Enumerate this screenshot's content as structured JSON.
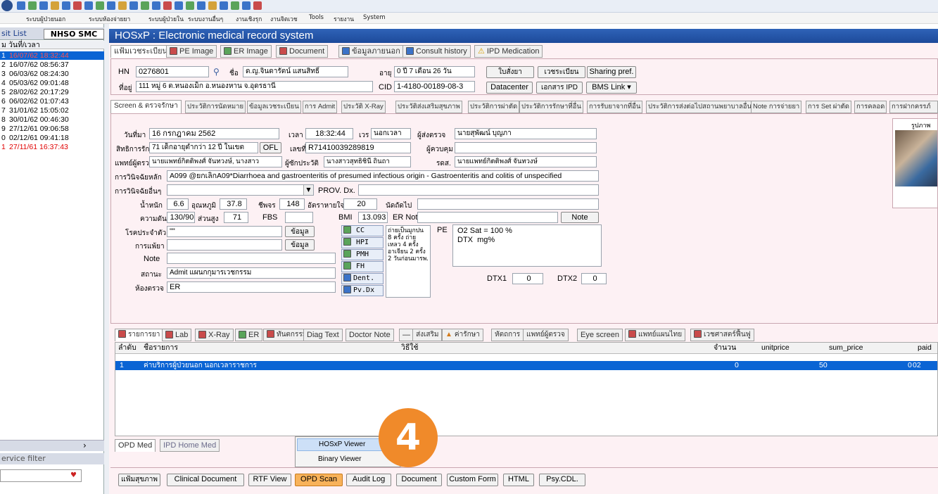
{
  "menubar": [
    "ระบบผู้ป่วยนอก",
    "ระบบห้องจ่ายยา",
    "ระบบผู้ป่วยใน",
    "ระบบงานอื่นๆ",
    "งานเชิงรุก",
    "งานจิตเวช",
    "Tools",
    "รายงาน",
    "System"
  ],
  "left": {
    "title": "sit List",
    "badge": "NHSO SMC",
    "col1": "ม",
    "col2": "วันที่/เวลา",
    "rows": [
      {
        "n": "1",
        "d": "16/07/62 18:32:44"
      },
      {
        "n": "2",
        "d": "16/07/62 08:56:37"
      },
      {
        "n": "3",
        "d": "06/03/62 08:24:30"
      },
      {
        "n": "4",
        "d": "05/03/62 09:01:48"
      },
      {
        "n": "5",
        "d": "28/02/62 20:17:29"
      },
      {
        "n": "6",
        "d": "06/02/62 01:07:43"
      },
      {
        "n": "7",
        "d": "31/01/62 15:05:02"
      },
      {
        "n": "8",
        "d": "30/01/62 00:46:30"
      },
      {
        "n": "9",
        "d": "27/12/61 09:06:58"
      },
      {
        "n": "0",
        "d": "02/12/61 09:41:18"
      },
      {
        "n": "1",
        "d": "27/11/61 16:37:43"
      }
    ],
    "service_filter": "ervice filter",
    "arrow": "›",
    "dropdown_mark": "♥"
  },
  "header": {
    "title": "HOSxP :  Electronic medical record system"
  },
  "top_tabs": [
    "แฟ้มเวชระเบียน",
    "PE Image",
    "ER Image",
    "Document",
    "ข้อมูลภายนอก",
    "Consult history",
    "IPD Medication"
  ],
  "patient": {
    "hn_label": "HN",
    "hn": "0276801",
    "name_label": "ชื่อ",
    "name": "ด.ญ.จินดารัตน์ แสนสิทธิ์",
    "age_label": "อายุ",
    "age": "0 ปี 7 เดือน 26 วัน",
    "addr_label": "ที่อยู่",
    "addr": "111 หมู่ 6 ต.หนองเม็ก อ.หนองหาน จ.อุดรธานี",
    "cid_label": "CID",
    "cid": "1-4180-00189-08-3",
    "btn_order": "ใบสั่งยา",
    "btn_reg": "เวชระเบียน",
    "btn_share": "Sharing pref.",
    "btn_dc": "Datacenter",
    "btn_ipd": "เอกสาร IPD",
    "btn_bms": "BMS Link ▾"
  },
  "mid_tabs": [
    "Screen & ตรวจรักษา",
    "ประวัติการนัดหมาย",
    "ข้อมูลเวชระเบียน",
    "การ Admit",
    "ประวัติ X-Ray",
    "ประวัติส่งเสริมสุขภาพ",
    "ประวัติการผ่าตัด",
    "ประวัติการรักษาที่อื่น",
    "การรับยาจากที่อื่น",
    "ประวัติการส่งต่อไปสถานพยาบาลอื่น",
    "Note การจ่ายยา",
    "การ Set ผ่าตัด",
    "การคลอด",
    "การฝากครรภ์"
  ],
  "screen": {
    "date_label": "วันที่มา",
    "date": "16 กรกฎาคม 2562",
    "time_label": "เวลา",
    "time": "18:32:44",
    "shift_label": "เวร",
    "shift": "นอกเวลา",
    "sender_label": "ผู้ส่งตรวจ",
    "sender": "นายสุพัฒน์ บุญภา",
    "right_label": "สิทธิการรักษา",
    "right": "71 เด็กอายุต่ำกว่า 12 ปี ในเขต",
    "ofl": "OFL",
    "no_label": "เลขที่",
    "no": "R71410039289819",
    "ctrl_label": "ผู้ควบคุม",
    "ctrl": "",
    "doctor_label": "แพทย์ผู้ตรวจ",
    "doctor": "นายแพทย์กิตติพงศ์ จันทวงษ์, นางสาว",
    "hist_label": "ผู้ซักประวัติ",
    "hist": "นางสาวสุทธิชินี ถินถา",
    "rds_label": "รดส.",
    "rds": "นายแพทย์กิตติพงศ์ จันทวงษ์",
    "dx_label": "การวินิจฉัยหลัก",
    "dx": "A099 @ยกเลิกA09*Diarrhoea and gastroenteritis of presumed infectious origin - Gastroenteritis and colitis of unspecified",
    "odx_label": "การวินิจฉัยอื่นๆ",
    "odx": "",
    "prov_label": "PROV. Dx.",
    "prov": "",
    "wt_label": "น้ำหนัก",
    "wt": "6.6",
    "temp_label": "อุณหภูมิ",
    "temp": "37.8",
    "pulse_label": "ชีพจร",
    "pulse": "148",
    "rr_label": "อัตราหายใจ",
    "rr": "20",
    "appt_label": "นัดถัดไป",
    "appt": "",
    "bp_label": "ความดัน",
    "bp": "130/90",
    "ht_label": "ส่วนสูง",
    "ht": "71",
    "fbs_label": "FBS",
    "fbs": "",
    "bmi_label": "BMI",
    "bmi": "13.093",
    "ernote_label": "ER Note",
    "ernote": "",
    "note_btn": "Note",
    "cd_label": "โรคประจำตัว",
    "cd": "\"\"",
    "info_btn": "ข้อมูล",
    "drug_label": "การแพ้ยา",
    "drug": "",
    "note_label": "Note",
    "note": "",
    "status_label": "สถานะ",
    "status": "Admit แผนกกุมารเวชกรรม",
    "room_label": "ห้องตรวจ",
    "room": "ER",
    "side_buttons": [
      "CC",
      "HPI",
      "PMH",
      "FH",
      "Dent.",
      "Pv.Dx"
    ],
    "cc_text": "ถ่ายเป็นมูกปน 8 ครั้ง ถ่ายเหลว 4 ครั้ง อาเจียน 2 ครั้ง 2 วันก่อนมารพ.",
    "pe_label": "PE",
    "pe_text": "O2 Sat = 100 %\nDTX  mg%",
    "dtx1_label": "DTX1",
    "dtx1": "0",
    "dtx2_label": "DTX2",
    "dtx2": "0",
    "photo_label": "รูปภาพ"
  },
  "bottom_tabs": [
    "รายการยา",
    "Lab",
    "X-Ray",
    "ER",
    "ทันตกรรม",
    "Diag Text",
    "Doctor Note",
    "—",
    "ส่งเสริม",
    "ค่ารักษา",
    "หัตถการ",
    "แพทย์ผู้ตรวจ",
    "Eye screen",
    "แพทย์แผนไทย",
    "เวชศาสตร์ฟื้นฟู"
  ],
  "grid": {
    "headers": [
      "ลำดับ",
      "ชื่อรายการ",
      "วิธีใช้",
      "จำนวน",
      "unitprice",
      "sum_price",
      "paid"
    ],
    "rows": [
      [
        "1",
        "ค่าบริการผู้ป่วยนอก นอกเวลาราชการ",
        "",
        "0",
        "50",
        "0",
        "02"
      ]
    ]
  },
  "med_tabs": [
    "OPD Med",
    "IPD Home Med"
  ],
  "context_menu": [
    "HOSxP Viewer",
    "Binary Viewer"
  ],
  "badge_number": "4",
  "footer_buttons": [
    "แฟ้มสุขภาพ",
    "Clinical Document",
    "RTF View",
    "OPD Scan",
    "Audit Log",
    "Document",
    "Custom Form",
    "HTML",
    "Psy.CDL."
  ],
  "colors": {
    "title_blue": "#1d4a9a",
    "select_blue": "#0a64d4",
    "pink_bg": "#fdf1f4",
    "badge_orange": "#f08a2a"
  }
}
